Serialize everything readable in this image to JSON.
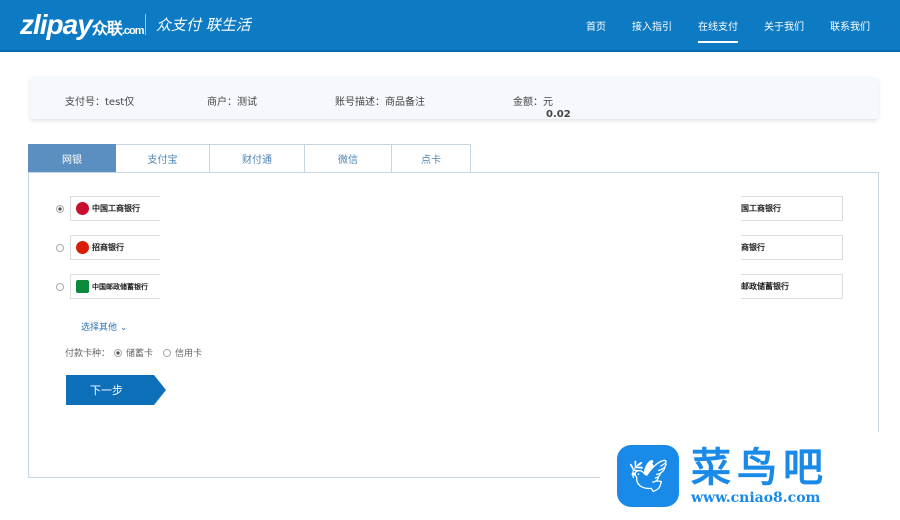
{
  "header": {
    "logo": "zlipay",
    "logo_cn": "众联",
    "logo_domain": ".com",
    "slogan": "众支付 联生活",
    "nav": [
      "首页",
      "接入指引",
      "在线支付",
      "关于我们",
      "联系我们"
    ],
    "active_nav": 2
  },
  "order": {
    "pay_no": "支付号：test仅",
    "merchant": "商户：测试",
    "desc": "账号描述：商品备注",
    "amount_label": "金额：",
    "amount": "0.02",
    "currency": "元"
  },
  "tabs": [
    "网银",
    "支付宝",
    "财付通",
    "微信",
    "点卡"
  ],
  "banks": [
    {
      "name": "中国工商银行",
      "right": "国工商银行",
      "color": "#c8102e",
      "selected": true
    },
    {
      "name": "招商银行",
      "right": "商银行",
      "color": "#d81e06",
      "selected": false
    },
    {
      "name": "中国邮政储蓄银行",
      "right": "邮政储蓄银行",
      "color": "#0a8a3a",
      "selected": false
    }
  ],
  "more_label": "选择其他",
  "more_icon": "chevron-down-icon",
  "card_type": {
    "label": "付款卡种：",
    "options": [
      "储蓄卡",
      "信用卡"
    ],
    "selected": 0
  },
  "next_label": "下一步",
  "watermark": {
    "title": "菜鸟吧",
    "url": "www.cniao8.com"
  },
  "colors": {
    "brand": "#0d7ac4",
    "amount": "#f08a1c",
    "tab_active": "#5b8ec1"
  }
}
